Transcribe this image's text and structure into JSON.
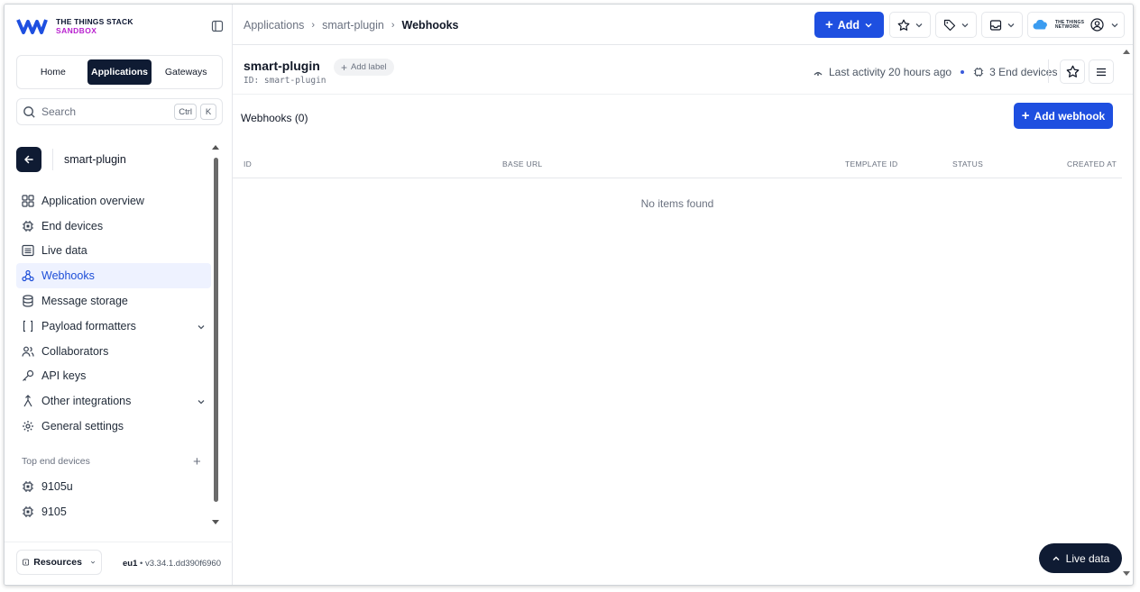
{
  "brand": {
    "line1": "THE THINGS STACK",
    "line2": "SANDBOX",
    "accent": "#b81fcf"
  },
  "switcher": {
    "items": [
      "Home",
      "Applications",
      "Gateways"
    ],
    "active": "Applications"
  },
  "search": {
    "placeholder": "Search",
    "kbd1": "Ctrl",
    "kbd2": "K"
  },
  "app": {
    "name": "smart-plugin",
    "id_label": "ID: smart-plugin",
    "add_label": "Add label"
  },
  "nav": {
    "items": [
      {
        "label": "Application overview",
        "icon": "grid-icon"
      },
      {
        "label": "End devices",
        "icon": "chip-icon"
      },
      {
        "label": "Live data",
        "icon": "list-icon"
      },
      {
        "label": "Webhooks",
        "icon": "webhook-icon",
        "active": true
      },
      {
        "label": "Message storage",
        "icon": "database-icon"
      },
      {
        "label": "Payload formatters",
        "icon": "code-icon",
        "expandable": true
      },
      {
        "label": "Collaborators",
        "icon": "users-icon"
      },
      {
        "label": "API keys",
        "icon": "key-icon"
      },
      {
        "label": "Other integrations",
        "icon": "integration-icon",
        "expandable": true
      },
      {
        "label": "General settings",
        "icon": "gear-icon"
      }
    ]
  },
  "top_devices": {
    "label": "Top end devices",
    "items": [
      "9105u",
      "9105"
    ]
  },
  "footer": {
    "resources": "Resources",
    "region": "eu1",
    "version": "v3.34.1.dd390f6960"
  },
  "breadcrumb": {
    "items": [
      "Applications",
      "smart-plugin",
      "Webhooks"
    ]
  },
  "topbar": {
    "add": "Add",
    "ttn_line1": "THE THINGS",
    "ttn_line2": "NETWORK"
  },
  "header": {
    "last_activity": "Last activity 20 hours ago",
    "end_devices": "3 End devices"
  },
  "content": {
    "title": "Webhooks (0)",
    "add_webhook": "Add webhook",
    "columns": [
      "ID",
      "BASE URL",
      "TEMPLATE ID",
      "STATUS",
      "CREATED AT"
    ],
    "empty": "No items found"
  },
  "live_data_button": "Live data",
  "colors": {
    "primary": "#1e4fe0",
    "dark": "#0f1b33",
    "active_bg": "#eef2ff",
    "active_text": "#1d4ed8"
  }
}
